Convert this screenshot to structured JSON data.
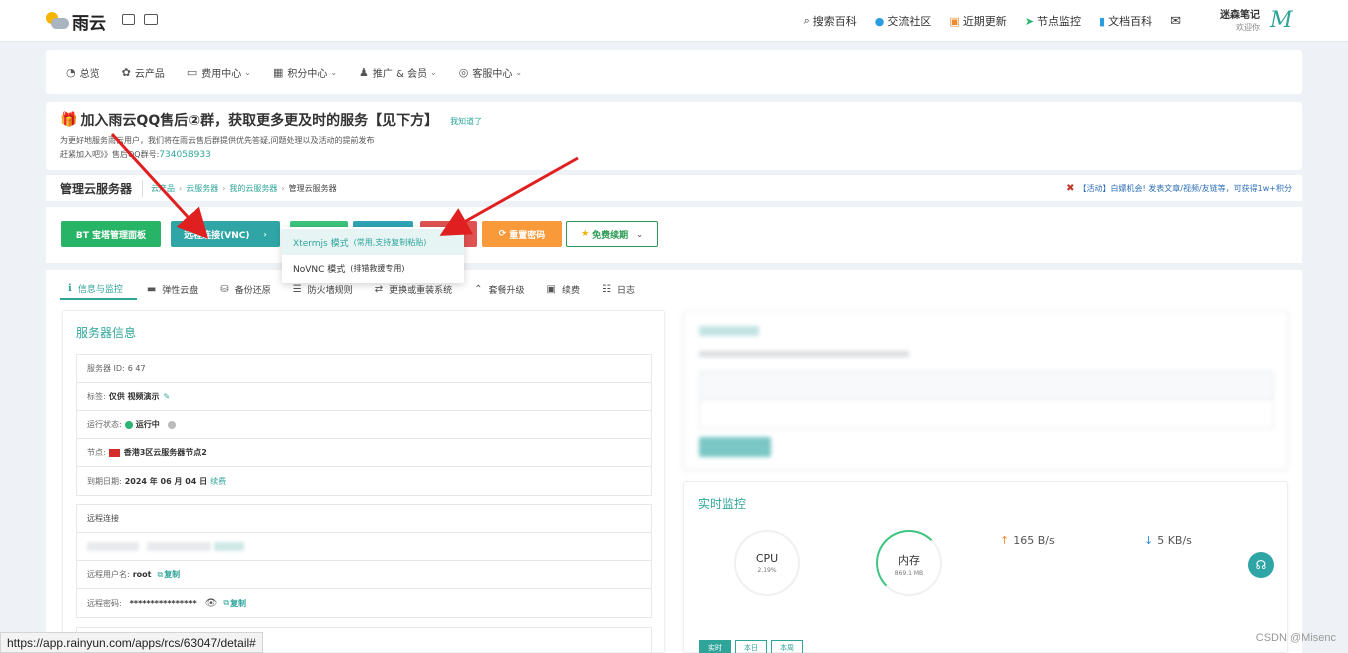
{
  "topbar": {
    "brand": "雨云",
    "nav": [
      {
        "icon": "search-icon",
        "glyph": "🔍",
        "label": "搜索百科"
      },
      {
        "icon": "community-icon",
        "glyph": "●",
        "label": "交流社区"
      },
      {
        "icon": "update-icon",
        "glyph": "▣",
        "label": "近期更新"
      },
      {
        "icon": "node-monitor-icon",
        "glyph": "➤",
        "label": "节点监控"
      },
      {
        "icon": "docs-icon",
        "glyph": "▮",
        "label": "文档百科"
      },
      {
        "icon": "mail-icon",
        "glyph": "✉",
        "label": ""
      }
    ],
    "user_name": "迷森笔记",
    "user_welcome": "欢迎你",
    "avatar": "M"
  },
  "menu": [
    {
      "icon": "dashboard-icon",
      "glyph": "◔",
      "label": "总览",
      "dropdown": false
    },
    {
      "icon": "cloud-products-icon",
      "glyph": "✿",
      "label": "云产品",
      "dropdown": false
    },
    {
      "icon": "billing-icon",
      "glyph": "▭",
      "label": "费用中心",
      "dropdown": true
    },
    {
      "icon": "points-icon",
      "glyph": "▦",
      "label": "积分中心",
      "dropdown": true
    },
    {
      "icon": "promotion-icon",
      "glyph": "♟",
      "label": "推广 & 会员",
      "dropdown": true
    },
    {
      "icon": "support-icon",
      "glyph": "◎",
      "label": "客服中心",
      "dropdown": true
    }
  ],
  "notice": {
    "title": "加入雨云QQ售后②群，获取更多更及时的服务【见下方】",
    "know": "我知道了",
    "line1": "为更好地服务雨云用户，我们将在雨云售后群提供优先答疑,问题处理以及活动的提前发布",
    "line2_prefix": "赶紧加入吧》》售后QQ群号:",
    "qq": "734058933"
  },
  "breadcrumb": {
    "page_title": "管理云服务器",
    "items": [
      "云产品",
      "云服务器",
      "我的云服务器"
    ],
    "current": "管理云服务器",
    "activity": "【活动】白嫖机会! 发表文章/视频/友链等，可获得1w+积分"
  },
  "actions": {
    "bt_panel": "BT 宝塔管理面板",
    "vnc": "远程连接(VNC)",
    "reset_password": "重置密码",
    "free_renew": "免费续期"
  },
  "vnc_menu": [
    {
      "label": "Xtermjs 模式",
      "sub": "(常用,支持复制粘贴)"
    },
    {
      "label": "NoVNC 模式",
      "sub": "(排错救援专用)"
    }
  ],
  "tabs": [
    {
      "icon": "info-icon",
      "glyph": "ℹ",
      "label": "信息与监控",
      "active": true
    },
    {
      "icon": "disk-icon",
      "glyph": "▬",
      "label": "弹性云盘"
    },
    {
      "icon": "backup-icon",
      "glyph": "⛁",
      "label": "备份还原"
    },
    {
      "icon": "firewall-icon",
      "glyph": "☰",
      "label": "防火墙规则"
    },
    {
      "icon": "reinstall-icon",
      "glyph": "⇄",
      "label": "更换或重装系统"
    },
    {
      "icon": "upgrade-icon",
      "glyph": "⌃",
      "label": "套餐升级"
    },
    {
      "icon": "renew-icon",
      "glyph": "▣",
      "label": "续费"
    },
    {
      "icon": "log-icon",
      "glyph": "☷",
      "label": "日志"
    }
  ],
  "server_info": {
    "title": "服务器信息",
    "id_label": "服务器 ID:",
    "id_value": "6   47",
    "tag_label": "标签:",
    "tag_value": "仅供 视频演示",
    "status_label": "运行状态:",
    "status_value": "运行中",
    "node_label": "节点:",
    "node_value": "香港3区云服务器节点2",
    "expire_label": "到期日期:",
    "expire_value": "2024 年 06 月 04 日",
    "expire_action": "续费"
  },
  "remote": {
    "title": "远程连接",
    "user_label": "远程用户名:",
    "user_value": "root",
    "copy": "复制",
    "pwd_label": "远程密码:",
    "pwd_value": "****************"
  },
  "monitor": {
    "title": "实时监控",
    "cpu_label": "CPU",
    "cpu_value": "2.19%",
    "mem_label": "内存",
    "mem_value": "869.1 MB",
    "net_up": "165 B/s",
    "net_down": "5 KB/s",
    "ranges": [
      "实时",
      "本日",
      "本周"
    ]
  },
  "statusbar_url": "https://app.rainyun.com/apps/rcs/63047/detail#",
  "watermark": "CSDN @Misenc",
  "colors": {
    "accent": "#2fa59a",
    "bt_green": "#28b466",
    "reset_orange": "#f89a3a",
    "arrow_red": "#e02020"
  }
}
